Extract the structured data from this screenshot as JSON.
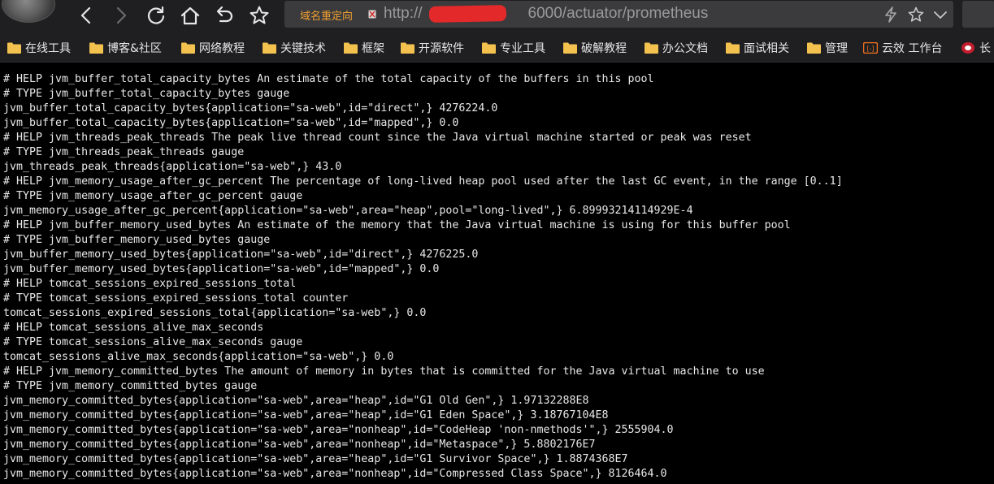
{
  "browser": {
    "url_tag": "域名重定向",
    "url_prefix": "http://",
    "url_suffix": "6000/actuator/prometheus",
    "colors": {
      "chrome_bg": "#1f1f21",
      "url_bg": "#3b3b3d",
      "url_tag": "#f0a030",
      "redaction": "#e4292a",
      "folder": "#f2c14e"
    },
    "icons": [
      "back-icon",
      "forward-icon",
      "reload-icon",
      "home-icon",
      "undo-icon",
      "star-icon",
      "lightning-icon",
      "star-outline-icon",
      "chevron-down-icon"
    ]
  },
  "bookmarks": [
    {
      "label": "在线工具"
    },
    {
      "label": "博客&社区"
    },
    {
      "label": "网络教程"
    },
    {
      "label": "关键技术"
    },
    {
      "label": "框架"
    },
    {
      "label": "开源软件"
    },
    {
      "label": "专业工具"
    },
    {
      "label": "破解教程"
    },
    {
      "label": "办公文档"
    },
    {
      "label": "面试相关"
    },
    {
      "label": "管理"
    },
    {
      "label": "云效 工作台"
    },
    {
      "label": "长"
    }
  ],
  "content": {
    "lines": [
      "# HELP jvm_buffer_total_capacity_bytes An estimate of the total capacity of the buffers in this pool",
      "# TYPE jvm_buffer_total_capacity_bytes gauge",
      "jvm_buffer_total_capacity_bytes{application=\"sa-web\",id=\"direct\",} 4276224.0",
      "jvm_buffer_total_capacity_bytes{application=\"sa-web\",id=\"mapped\",} 0.0",
      "# HELP jvm_threads_peak_threads The peak live thread count since the Java virtual machine started or peak was reset",
      "# TYPE jvm_threads_peak_threads gauge",
      "jvm_threads_peak_threads{application=\"sa-web\",} 43.0",
      "# HELP jvm_memory_usage_after_gc_percent The percentage of long-lived heap pool used after the last GC event, in the range [0..1]",
      "# TYPE jvm_memory_usage_after_gc_percent gauge",
      "jvm_memory_usage_after_gc_percent{application=\"sa-web\",area=\"heap\",pool=\"long-lived\",} 6.89993214114929E-4",
      "# HELP jvm_buffer_memory_used_bytes An estimate of the memory that the Java virtual machine is using for this buffer pool",
      "# TYPE jvm_buffer_memory_used_bytes gauge",
      "jvm_buffer_memory_used_bytes{application=\"sa-web\",id=\"direct\",} 4276225.0",
      "jvm_buffer_memory_used_bytes{application=\"sa-web\",id=\"mapped\",} 0.0",
      "# HELP tomcat_sessions_expired_sessions_total",
      "# TYPE tomcat_sessions_expired_sessions_total counter",
      "tomcat_sessions_expired_sessions_total{application=\"sa-web\",} 0.0",
      "# HELP tomcat_sessions_alive_max_seconds",
      "# TYPE tomcat_sessions_alive_max_seconds gauge",
      "tomcat_sessions_alive_max_seconds{application=\"sa-web\",} 0.0",
      "# HELP jvm_memory_committed_bytes The amount of memory in bytes that is committed for the Java virtual machine to use",
      "# TYPE jvm_memory_committed_bytes gauge",
      "jvm_memory_committed_bytes{application=\"sa-web\",area=\"heap\",id=\"G1 Old Gen\",} 1.97132288E8",
      "jvm_memory_committed_bytes{application=\"sa-web\",area=\"heap\",id=\"G1 Eden Space\",} 3.18767104E8",
      "jvm_memory_committed_bytes{application=\"sa-web\",area=\"nonheap\",id=\"CodeHeap 'non-nmethods'\",} 2555904.0",
      "jvm_memory_committed_bytes{application=\"sa-web\",area=\"nonheap\",id=\"Metaspace\",} 5.8802176E7",
      "jvm_memory_committed_bytes{application=\"sa-web\",area=\"heap\",id=\"G1 Survivor Space\",} 1.8874368E7",
      "jvm_memory_committed_bytes{application=\"sa-web\",area=\"nonheap\",id=\"Compressed Class Space\",} 8126464.0"
    ]
  }
}
